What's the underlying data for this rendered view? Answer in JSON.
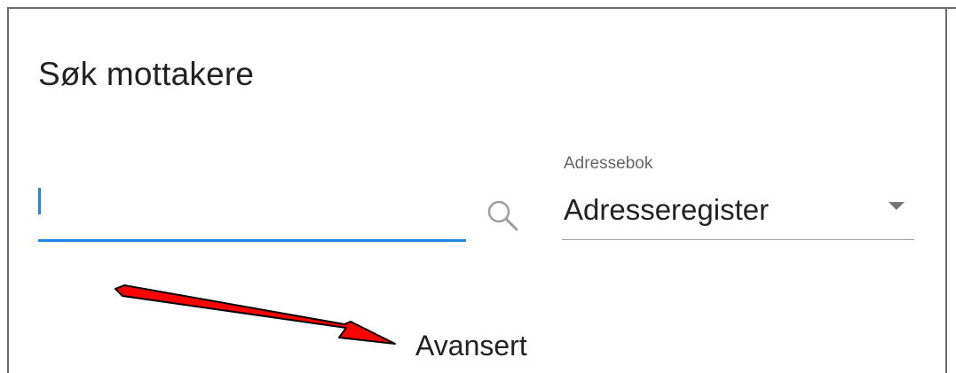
{
  "dialog": {
    "title": "Søk mottakere"
  },
  "search": {
    "value": "",
    "placeholder": "",
    "icon": "search-icon"
  },
  "addressbook": {
    "label": "Adressebok",
    "selected": "Adresseregister",
    "icon": "caret-down-icon"
  },
  "advanced": {
    "label": "Avansert"
  },
  "annotation": {
    "arrow_color": "#ff0000"
  },
  "colors": {
    "accent": "#1e88e5",
    "text": "#222222",
    "secondary_text": "#666666",
    "frame": "#6b6b6b"
  }
}
